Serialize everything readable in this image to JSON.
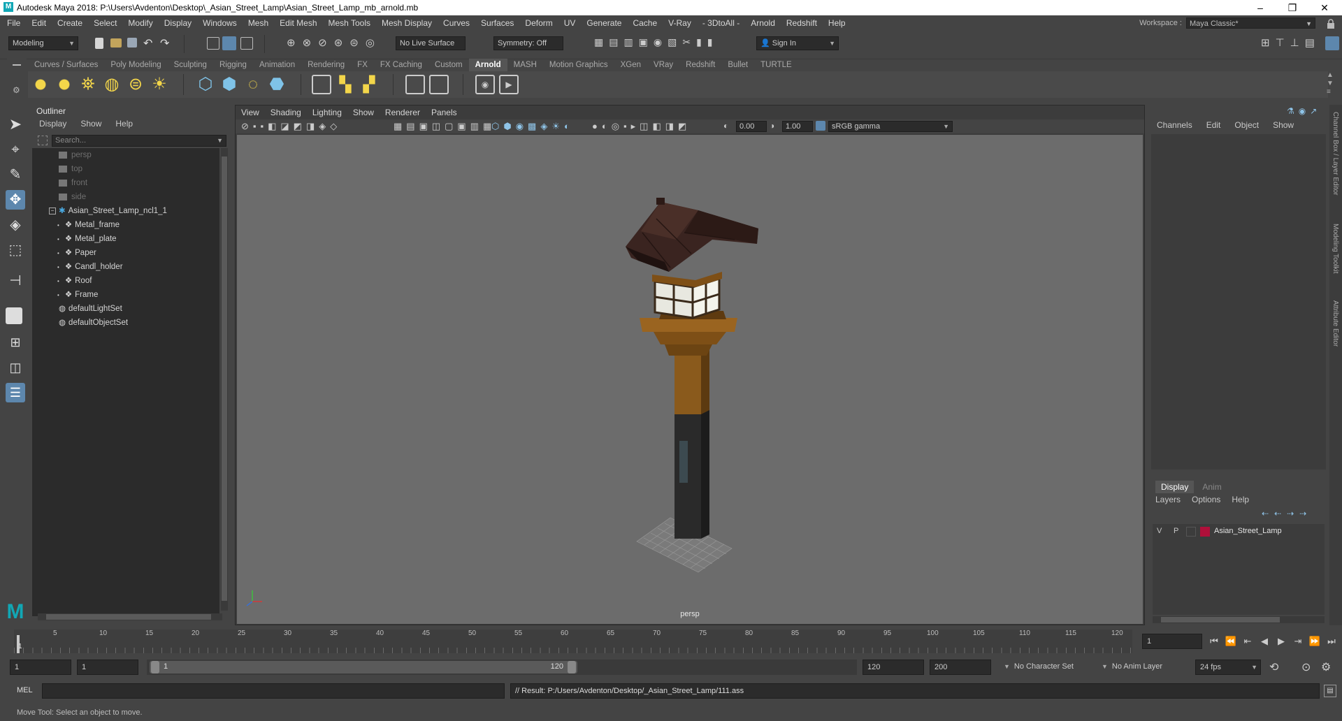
{
  "window": {
    "app_logo": "M",
    "title": "Autodesk Maya 2018: P:\\Users\\Avdenton\\Desktop\\_Asian_Street_Lamp\\Asian_Street_Lamp_mb_arnold.mb",
    "controls": [
      "–",
      "❐",
      "✕"
    ]
  },
  "menubar": {
    "items": [
      "File",
      "Edit",
      "Create",
      "Select",
      "Modify",
      "Display",
      "Windows",
      "Mesh",
      "Edit Mesh",
      "Mesh Tools",
      "Mesh Display",
      "Curves",
      "Surfaces",
      "Deform",
      "UV",
      "Generate",
      "Cache",
      "V-Ray",
      "- 3DtoAll -",
      "Arnold",
      "Redshift",
      "Help"
    ],
    "workspace_label": "Workspace :",
    "workspace_value": "Maya Classic*"
  },
  "statusline": {
    "mode": "Modeling",
    "live_surface": "No Live Surface",
    "symmetry": "Symmetry: Off",
    "sign_in": "Sign In"
  },
  "shelf": {
    "tabs": [
      "Curves / Surfaces",
      "Poly Modeling",
      "Sculpting",
      "Rigging",
      "Animation",
      "Rendering",
      "FX",
      "FX Caching",
      "Custom",
      "Arnold",
      "MASH",
      "Motion Graphics",
      "XGen",
      "VRay",
      "Redshift",
      "Bullet",
      "TURTLE"
    ],
    "active_tab": "Arnold"
  },
  "outliner": {
    "title": "Outliner",
    "menu": [
      "Display",
      "Show",
      "Help"
    ],
    "search_placeholder": "Search...",
    "items": [
      {
        "label": "persp",
        "dim": true,
        "indent": 0
      },
      {
        "label": "top",
        "dim": true,
        "indent": 0
      },
      {
        "label": "front",
        "dim": true,
        "indent": 0
      },
      {
        "label": "side",
        "dim": true,
        "indent": 0
      },
      {
        "label": "Asian_Street_Lamp_ncl1_1",
        "dim": false,
        "indent": 0,
        "expanded": true
      },
      {
        "label": "Metal_frame",
        "dim": false,
        "indent": 1
      },
      {
        "label": "Metal_plate",
        "dim": false,
        "indent": 1
      },
      {
        "label": "Paper",
        "dim": false,
        "indent": 1
      },
      {
        "label": "Candl_holder",
        "dim": false,
        "indent": 1
      },
      {
        "label": "Roof",
        "dim": false,
        "indent": 1
      },
      {
        "label": "Frame",
        "dim": false,
        "indent": 1
      },
      {
        "label": "defaultLightSet",
        "dim": false,
        "indent": 0
      },
      {
        "label": "defaultObjectSet",
        "dim": false,
        "indent": 0
      }
    ]
  },
  "viewport": {
    "menu": [
      "View",
      "Shading",
      "Lighting",
      "Show",
      "Renderer",
      "Panels"
    ],
    "exposure": "0.00",
    "gamma": "1.00",
    "color_space": "sRGB gamma",
    "camera_label": "persp"
  },
  "channelbox": {
    "menu": [
      "Channels",
      "Edit",
      "Object",
      "Show"
    ],
    "side_tabs": [
      "Channel Box / Layer Editor",
      "Modeling Toolkit",
      "Attribute Editor"
    ]
  },
  "layer_editor": {
    "tabs": [
      "Display",
      "Anim"
    ],
    "menu": [
      "Layers",
      "Options",
      "Help"
    ],
    "layer": {
      "v": "V",
      "p": "P",
      "name": "Asian_Street_Lamp",
      "color": "#b0103a"
    }
  },
  "timeline": {
    "ticks": [
      "1",
      "5",
      "10",
      "15",
      "20",
      "25",
      "30",
      "35",
      "40",
      "45",
      "50",
      "55",
      "60",
      "65",
      "70",
      "75",
      "80",
      "85",
      "90",
      "95",
      "100",
      "105",
      "110",
      "115",
      "120"
    ],
    "current_frame": "1"
  },
  "range": {
    "start": "1",
    "playback_start": "1",
    "slider_start": "1",
    "slider_end": "120",
    "playback_end": "120",
    "end": "200",
    "character_set": "No Character Set",
    "anim_layer": "No Anim Layer",
    "fps": "24 fps"
  },
  "commandline": {
    "label": "MEL",
    "result": "// Result: P:/Users/Avdenton/Desktop/_Asian_Street_Lamp/111.ass"
  },
  "helpline": {
    "text": "Move Tool: Select an object to move."
  },
  "colors": {
    "accent": "#5d87ad",
    "maya_logo": "#11a7b5",
    "viewport_bg": "#6c6c6c",
    "wood": "#8a5a1c",
    "roof": "#3a2420"
  }
}
